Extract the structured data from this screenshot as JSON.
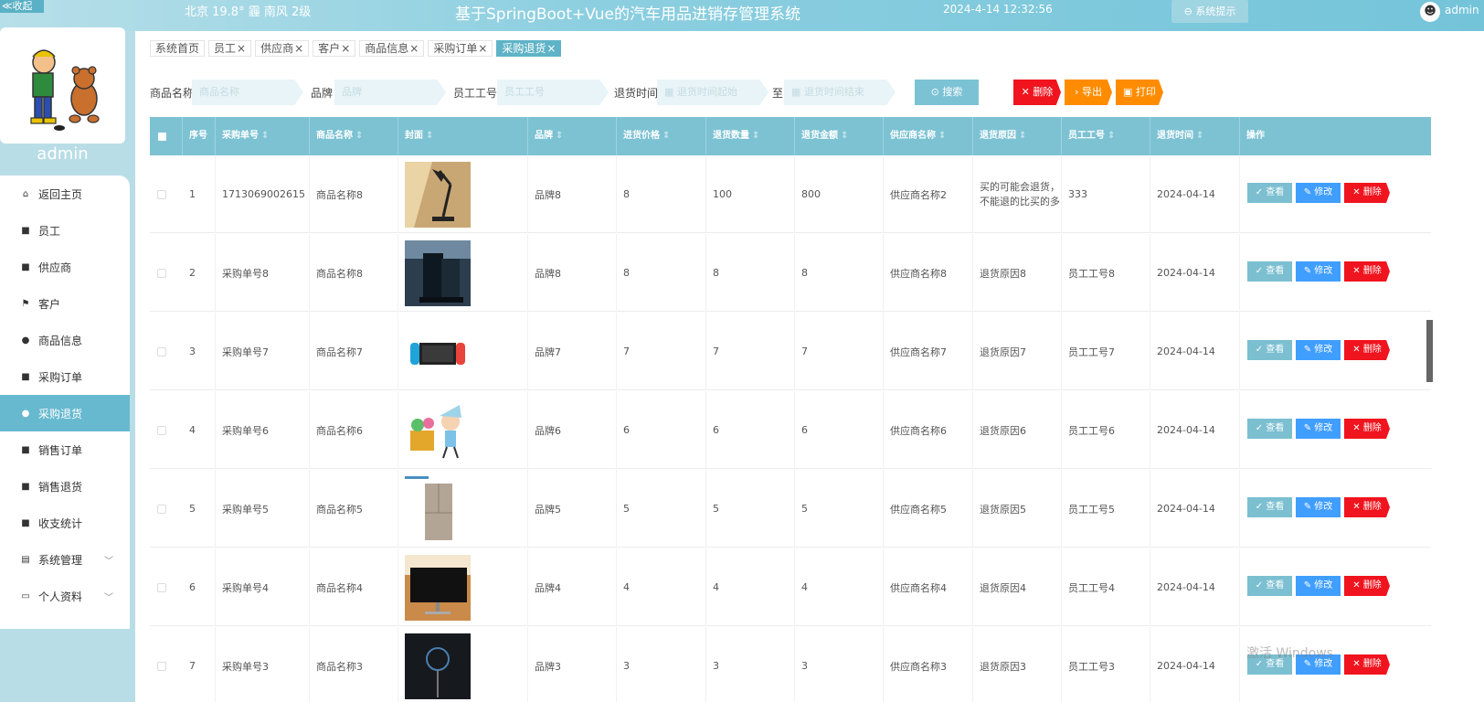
{
  "header": {
    "collapse_label": "≪收起",
    "weather": "北京  19.8°  霾  南风  2级",
    "title": "基于SpringBoot+Vue的汽车用品进销存管理系统",
    "datetime": "2024-4-14 12:32:56",
    "system_tip": "⊖ 系统提示",
    "username": "admin"
  },
  "profile": {
    "name": "admin"
  },
  "menu": [
    {
      "label": "返回主页",
      "icon": "home-icon",
      "glyph": "⌂"
    },
    {
      "label": "员工",
      "icon": "grid-icon",
      "glyph": "■"
    },
    {
      "label": "供应商",
      "icon": "store-icon",
      "glyph": "■"
    },
    {
      "label": "客户",
      "icon": "flag-icon",
      "glyph": "⚑"
    },
    {
      "label": "商品信息",
      "icon": "user-icon",
      "glyph": "●"
    },
    {
      "label": "采购订单",
      "icon": "grid-icon",
      "glyph": "■"
    },
    {
      "label": "采购退货",
      "icon": "bulb-icon",
      "glyph": "●"
    },
    {
      "label": "销售订单",
      "icon": "briefcase-icon",
      "glyph": "■"
    },
    {
      "label": "销售退货",
      "icon": "trophy-icon",
      "glyph": "■"
    },
    {
      "label": "收支统计",
      "icon": "grid-icon",
      "glyph": "■"
    },
    {
      "label": "系统管理",
      "icon": "chart-icon",
      "glyph": "▤"
    },
    {
      "label": "个人资料",
      "icon": "calendar-icon",
      "glyph": "▭"
    }
  ],
  "tabs": [
    {
      "label": "系统首页",
      "close": ""
    },
    {
      "label": "员工",
      "close": "×"
    },
    {
      "label": "供应商",
      "close": "×"
    },
    {
      "label": "客户",
      "close": "×"
    },
    {
      "label": "商品信息",
      "close": "×"
    },
    {
      "label": "采购订单",
      "close": "×"
    },
    {
      "label": "采购退货",
      "close": "×"
    }
  ],
  "search": {
    "product_label": "商品名称",
    "product_placeholder": "商品名称",
    "brand_label": "品牌",
    "brand_placeholder": "品牌",
    "emp_label": "员工工号",
    "emp_placeholder": "员工工号",
    "time_label": "退货时间",
    "time_start_placeholder": "▦ 退货时间起始",
    "to_label": "至",
    "time_end_placeholder": "▦ 退货时间结束",
    "search_btn": "⊙ 搜索",
    "delete_btn": "✕  删除",
    "export_btn": "›  导出",
    "print_btn": "▣  打印"
  },
  "colors": {
    "delete": "#f0141e",
    "export": "#ff8c00",
    "print": "#ff8c00"
  },
  "table": {
    "columns": [
      "序号",
      "采购单号",
      "商品名称",
      "封面",
      "品牌",
      "进货价格",
      "退货数量",
      "退货金额",
      "供应商名称",
      "退货原因",
      "员工工号",
      "退货时间",
      "操作"
    ],
    "sort_icon": "⇕",
    "rows": [
      {
        "idx": "1",
        "order": "1713069002615",
        "name": "商品名称8",
        "brand": "品牌8",
        "price": "8",
        "qty": "100",
        "amount": "800",
        "supplier": "供应商名称2",
        "reason": "买的可能会退货，不能退的比买的多",
        "emp": "333",
        "date": "2024-04-14"
      },
      {
        "idx": "2",
        "order": "采购单号8",
        "name": "商品名称8",
        "brand": "品牌8",
        "price": "8",
        "qty": "8",
        "amount": "8",
        "supplier": "供应商名称8",
        "reason": "退货原因8",
        "emp": "员工工号8",
        "date": "2024-04-14"
      },
      {
        "idx": "3",
        "order": "采购单号7",
        "name": "商品名称7",
        "brand": "品牌7",
        "price": "7",
        "qty": "7",
        "amount": "7",
        "supplier": "供应商名称7",
        "reason": "退货原因7",
        "emp": "员工工号7",
        "date": "2024-04-14"
      },
      {
        "idx": "4",
        "order": "采购单号6",
        "name": "商品名称6",
        "brand": "品牌6",
        "price": "6",
        "qty": "6",
        "amount": "6",
        "supplier": "供应商名称6",
        "reason": "退货原因6",
        "emp": "员工工号6",
        "date": "2024-04-14"
      },
      {
        "idx": "5",
        "order": "采购单号5",
        "name": "商品名称5",
        "brand": "品牌5",
        "price": "5",
        "qty": "5",
        "amount": "5",
        "supplier": "供应商名称5",
        "reason": "退货原因5",
        "emp": "员工工号5",
        "date": "2024-04-14"
      },
      {
        "idx": "6",
        "order": "采购单号4",
        "name": "商品名称4",
        "brand": "品牌4",
        "price": "4",
        "qty": "4",
        "amount": "4",
        "supplier": "供应商名称4",
        "reason": "退货原因4",
        "emp": "员工工号4",
        "date": "2024-04-14"
      },
      {
        "idx": "7",
        "order": "采购单号3",
        "name": "商品名称3",
        "brand": "品牌3",
        "price": "3",
        "qty": "3",
        "amount": "3",
        "supplier": "供应商名称3",
        "reason": "退货原因3",
        "emp": "员工工号3",
        "date": "2024-04-14"
      }
    ],
    "actions": {
      "view": "✓ 查看",
      "edit": "✎ 修改",
      "delete": "✕ 删除"
    }
  },
  "watermark": "激活 Windows"
}
